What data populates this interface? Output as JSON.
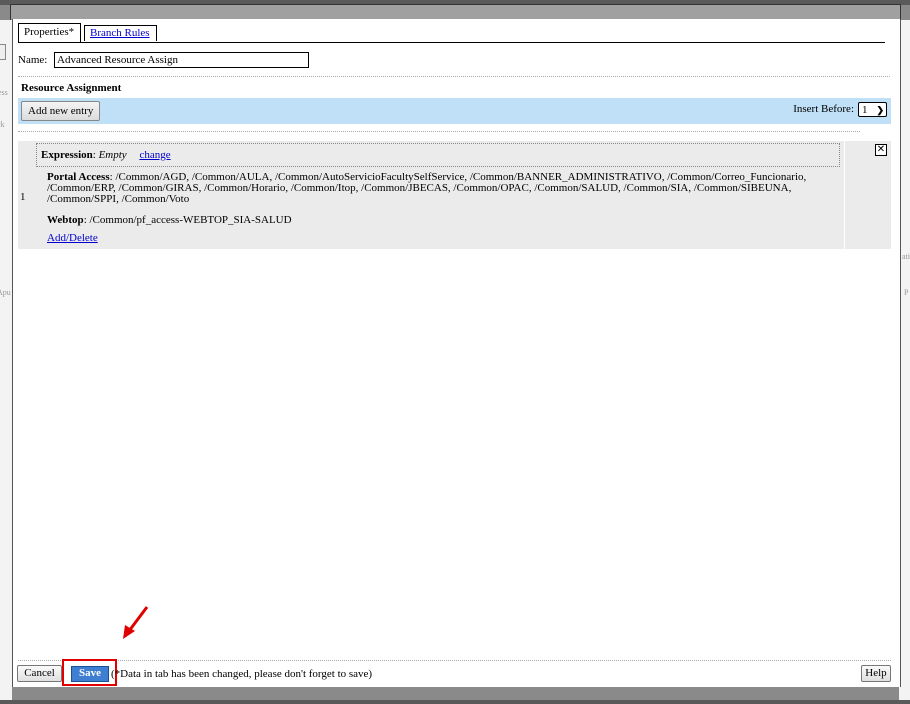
{
  "background": {
    "left_fragments": [
      "ess",
      "ck",
      "s",
      "Apu"
    ],
    "right_fragments": [
      "ati",
      "P"
    ]
  },
  "tabs": [
    {
      "label": "Properties*",
      "active": true
    },
    {
      "label": "Branch Rules",
      "active": false
    }
  ],
  "name_field": {
    "label": "Name:",
    "value": "Advanced Resource Assign"
  },
  "resource_assignment": {
    "title": "Resource Assignment",
    "add_button": "Add new entry",
    "insert_before_label": "Insert Before:",
    "insert_before_value": "1"
  },
  "entries": [
    {
      "index": "1",
      "expression_label": "Expression",
      "expression_value": "Empty",
      "change_link": "change",
      "portal_label": "Portal Access",
      "portal_value": "/Common/AGD, /Common/AULA, /Common/AutoServicioFacultySelfService, /Common/BANNER_ADMINISTRATIVO, /Common/Correo_Funcionario, /Common/ERP, /Common/GIRAS, /Common/Horario, /Common/Itop, /Common/JBECAS, /Common/OPAC, /Common/SALUD, /Common/SIA, /Common/SIBEUNA, /Common/SPPI, /Common/Voto",
      "webtop_label": "Webtop",
      "webtop_value": "/Common/pf_access-WEBTOP_SIA-SALUD",
      "add_delete_link": "Add/Delete",
      "delete_icon": "close-x-icon"
    }
  ],
  "footer": {
    "cancel": "Cancel",
    "save": "Save",
    "note": "(*Data in tab has been changed, please don't forget to save)",
    "help": "Help"
  },
  "colors": {
    "toolbar_bg": "#bfe0f7",
    "save_bg": "#3f7fd1",
    "highlight": "#e00000"
  }
}
